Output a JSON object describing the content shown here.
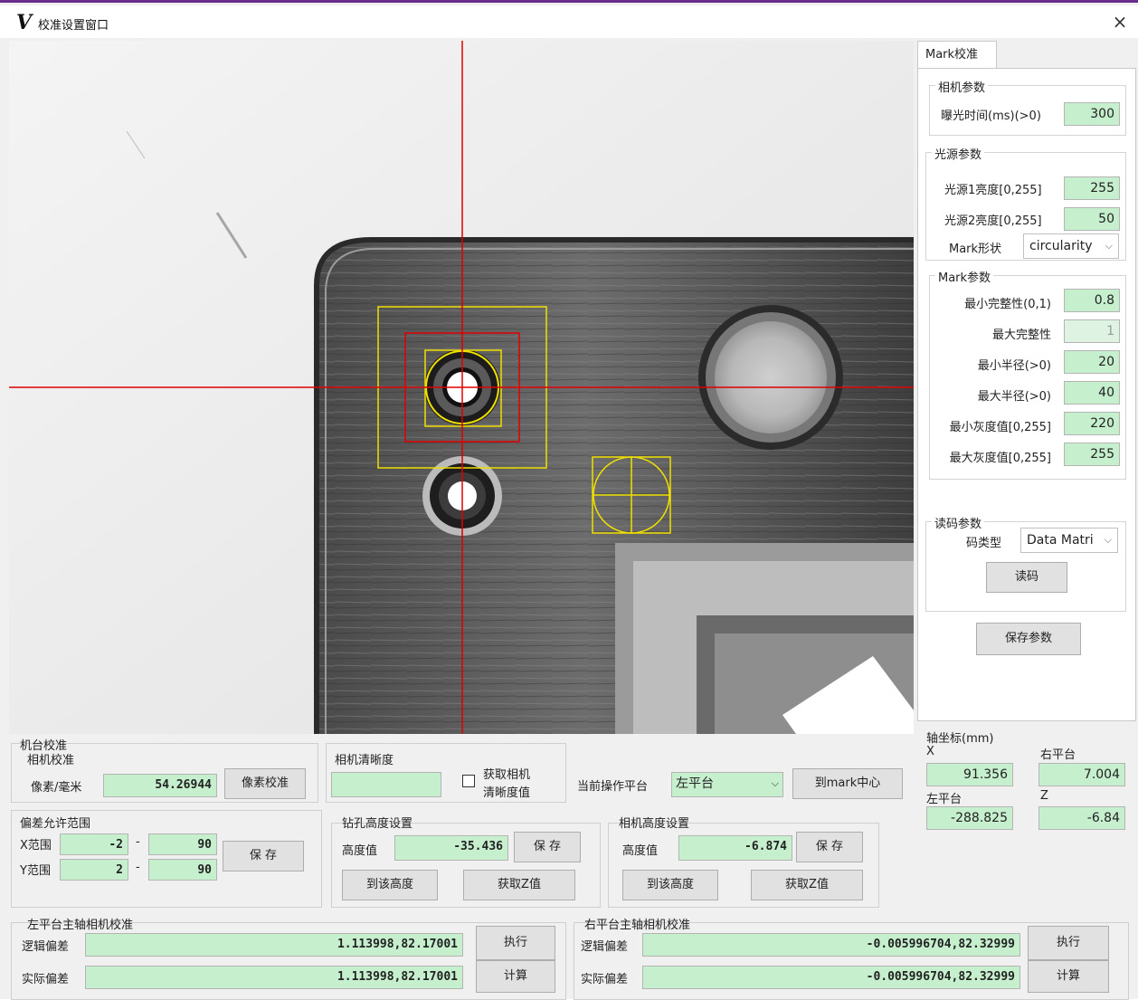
{
  "window": {
    "logo": "V",
    "title": "校准设置窗口",
    "close": "×"
  },
  "right_panel": {
    "tab": "Mark校准",
    "camera_params": {
      "title": "相机参数",
      "exposure_label": "曝光时间(ms)(>0)",
      "exposure_value": "300"
    },
    "light_params": {
      "title": "光源参数",
      "l1_label": "光源1亮度[0,255]",
      "l1_value": "255",
      "l2_label": "光源2亮度[0,255]",
      "l2_value": "50"
    },
    "mark_shape": {
      "label": "Mark形状",
      "value": "circularity"
    },
    "mark_params": {
      "title": "Mark参数",
      "min_integrity_label": "最小完整性(0,1)",
      "min_integrity_value": "0.8",
      "max_integrity_label": "最大完整性",
      "max_integrity_value": "1",
      "min_radius_label": "最小半径(>0)",
      "min_radius_value": "20",
      "max_radius_label": "最大半径(>0)",
      "max_radius_value": "40",
      "min_gray_label": "最小灰度值[0,255]",
      "min_gray_value": "220",
      "max_gray_label": "最大灰度值[0,255]",
      "max_gray_value": "255"
    },
    "code_params": {
      "title": "读码参数",
      "type_label": "码类型",
      "type_value": "Data Matri",
      "read_button": "读码"
    },
    "save_button": "保存参数"
  },
  "axis": {
    "title": "轴坐标(mm)",
    "x_label": "X",
    "x_value": "91.356",
    "right_label": "右平台",
    "right_value": "7.004",
    "left_label": "左平台",
    "left_value": "-288.825",
    "z_label": "Z",
    "z_value": "-6.84"
  },
  "machine_cal": {
    "title": "机台校准",
    "subtitle": "相机校准",
    "pixel_label": "像素/毫米",
    "pixel_value": "54.26944",
    "pixel_button": "像素校准"
  },
  "clarity": {
    "title": "相机清晰度",
    "value": "",
    "checkbox_label_1": "获取相机",
    "checkbox_label_2": "清晰度值"
  },
  "platform": {
    "label": "当前操作平台",
    "value": "左平台",
    "to_mark_button": "到mark中心"
  },
  "tolerance": {
    "title": "偏差允许范围",
    "x_label": "X范围",
    "x_min": "-2",
    "x_max": "90",
    "y_label": "Y范围",
    "y_min": "2",
    "y_max": "90",
    "dash": "-",
    "save_button": "保 存"
  },
  "drill_height": {
    "title": "钻孔高度设置",
    "label": "高度值",
    "value": "-35.436",
    "save_button": "保 存",
    "goto_button": "到该高度",
    "getz_button": "获取Z值"
  },
  "cam_height": {
    "title": "相机高度设置",
    "label": "高度值",
    "value": "-6.874",
    "save_button": "保 存",
    "goto_button": "到该高度",
    "getz_button": "获取Z值"
  },
  "left_spindle": {
    "title": "左平台主轴相机校准",
    "logic_label": "逻辑偏差",
    "logic_value": "1.113998,82.17001",
    "actual_label": "实际偏差",
    "actual_value": "1.113998,82.17001",
    "exec_button": "执行",
    "calc_button": "计算"
  },
  "right_spindle": {
    "title": "右平台主轴相机校准",
    "logic_label": "逻辑偏差",
    "logic_value": "-0.005996704,82.32999",
    "actual_label": "实际偏差",
    "actual_value": "-0.005996704,82.32999",
    "exec_button": "执行",
    "calc_button": "计算"
  }
}
